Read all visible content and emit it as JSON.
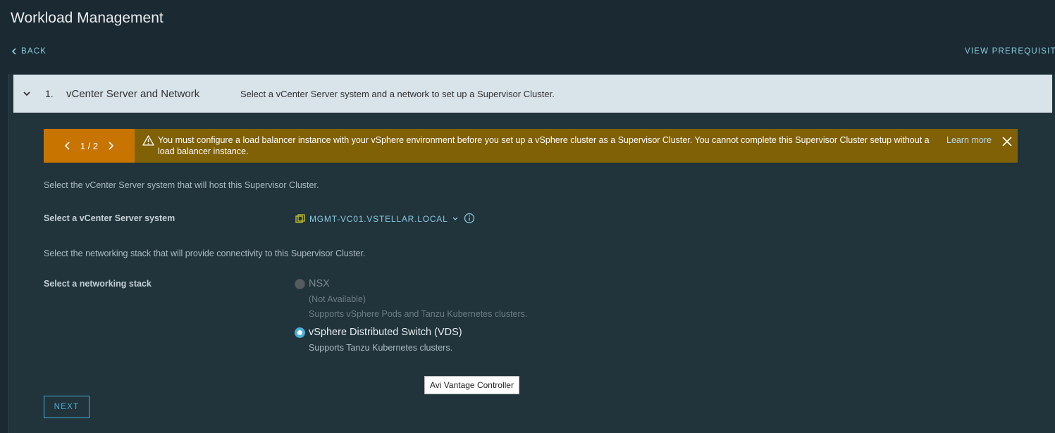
{
  "header": {
    "title": "Workload Management",
    "back_label": "BACK",
    "prereq_label": "VIEW PREREQUISITE"
  },
  "step": {
    "number": "1.",
    "name": "vCenter Server and Network",
    "description": "Select a vCenter Server system and a network to set up a Supervisor Cluster."
  },
  "alert": {
    "pager": "1 / 2",
    "message": "You must configure a load balancer instance with your vSphere environment before you set up a vSphere cluster as a Supervisor Cluster. You cannot complete this Supervisor Cluster setup without a load balancer instance.",
    "learn_more": "Learn more",
    "background_color": "#806106",
    "pager_color": "#c87400"
  },
  "vcenter": {
    "intro": "Select the vCenter Server system that will host this Supervisor Cluster.",
    "label": "Select a vCenter Server system",
    "value": "MGMT-VC01.VSTELLAR.LOCAL"
  },
  "network": {
    "intro": "Select the networking stack that will provide connectivity to this Supervisor Cluster.",
    "label": "Select a networking stack",
    "options": [
      {
        "label": "NSX",
        "note": "(Not Available)",
        "description": "Supports vSphere Pods and Tanzu Kubernetes clusters.",
        "disabled": true,
        "selected": false
      },
      {
        "label": "vSphere Distributed Switch (VDS)",
        "description": "Supports Tanzu Kubernetes clusters.",
        "disabled": false,
        "selected": true
      }
    ]
  },
  "tooltip": "Avi Vantage Controller",
  "actions": {
    "next_label": "NEXT"
  },
  "colors": {
    "accent": "#49afd9",
    "link": "#89cbdf",
    "background": "#1b2a32"
  }
}
